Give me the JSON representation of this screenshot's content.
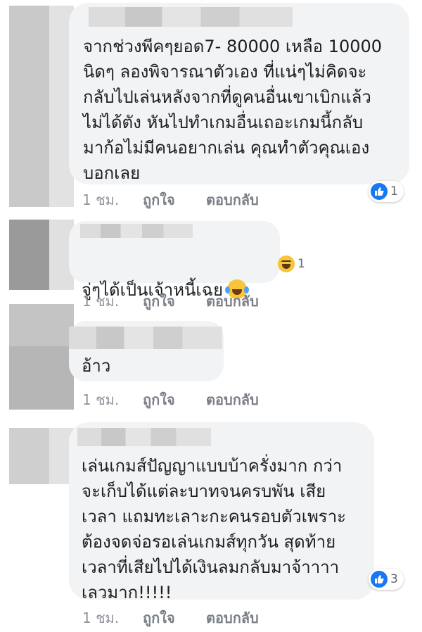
{
  "comments": [
    {
      "text": "จากช่วงพีคๆยอด7- 80000 เหลือ 10000\nนิดๆ ลองพิจารณาตัวเอง ที่แน่ๆไม่คิดจะ\nกลับไปเล่นหลังจากที่ดูคนอื่นเขาเบิกแล้ว\nไม่ได้ตัง หันไปทำเกมอื่นเถอะเกมนี้กลับ\nมาก้อไม่มีคนอยากเล่น คุณทำตัวคุณเอง\nบอกเลย",
      "reaction_count": "1",
      "reaction_icon": "like-icon",
      "time": "1 ชม.",
      "like_label": "ถูกใจ",
      "reply_label": "ตอบกลับ"
    },
    {
      "text": "จู่ๆได้เป็นเจ้าหนี้เฉย",
      "emoji": "laughing-tears-emoji",
      "reaction_count": "1",
      "reaction_icon": "haha-icon",
      "time": "1 ชม.",
      "like_label": "ถูกใจ",
      "reply_label": "ตอบกลับ"
    },
    {
      "text": "อ้าว",
      "time": "1 ชม.",
      "like_label": "ถูกใจ",
      "reply_label": "ตอบกลับ"
    },
    {
      "text": "เล่นเกมส์ปัญญาแบบบ้าครั่งมาก กว่า\nจะเก็บได้แต่ละบาทจนครบพัน  เสีย\nเวลา แถมทะเลาะกะคนรอบตัวเพราะ\nต้องจดจ่อรอเล่นเกมส์ทุกวัน สุดท้าย\nเวลาที่เสียไปได้เงินลมกลับมาจ้าาาา\nเลวมาก!!!!!",
      "reaction_count": "3",
      "reaction_icon": "like-icon",
      "time": "1 ชม.",
      "like_label": "ถูกใจ",
      "reply_label": "ตอบกลับ"
    }
  ],
  "colors": {
    "bubble": "#f2f3f5",
    "meta_text": "#90949c",
    "like_blue": "#1877f2"
  }
}
